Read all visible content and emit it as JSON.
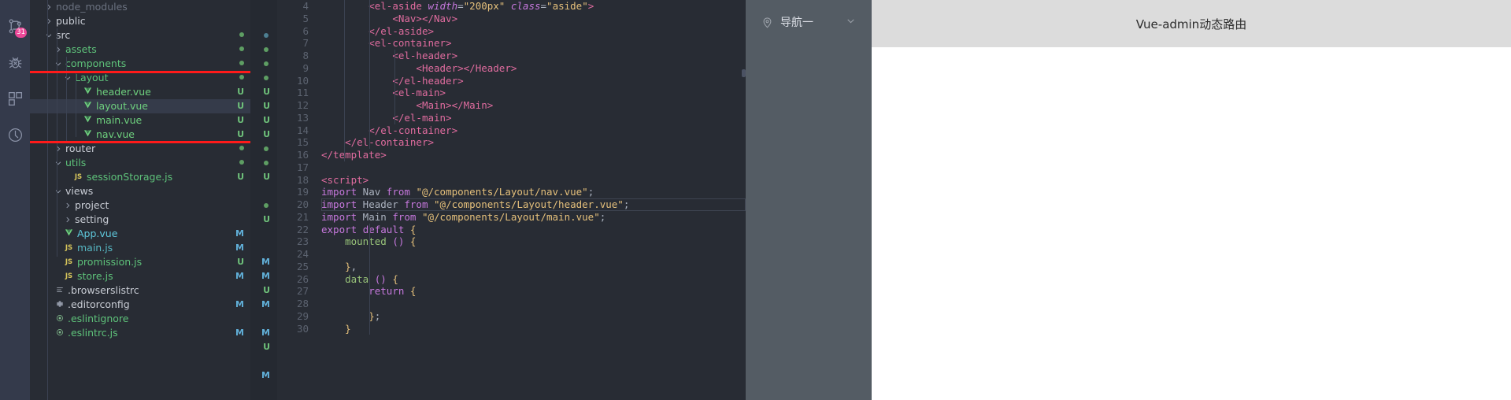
{
  "activitybar": {
    "items": [
      {
        "icon": "source-control-icon",
        "badge": "31"
      },
      {
        "icon": "debug-icon",
        "badge": ""
      },
      {
        "icon": "extensions-icon",
        "badge": ""
      },
      {
        "icon": "clock-icon",
        "badge": ""
      }
    ]
  },
  "explorer": {
    "rows": [
      {
        "label": "node_modules",
        "twisty": "right",
        "icon": "",
        "indent": 1,
        "color": "c-node",
        "status": "",
        "selected": false
      },
      {
        "label": "public",
        "twisty": "right",
        "icon": "",
        "indent": 1,
        "color": "c-folder",
        "status": "",
        "selected": false
      },
      {
        "label": "src",
        "twisty": "down",
        "icon": "",
        "indent": 1,
        "color": "c-folder",
        "status": "dot",
        "selected": false
      },
      {
        "label": "assets",
        "twisty": "right",
        "icon": "",
        "indent": 2,
        "color": "c-green",
        "status": "dot",
        "selected": false
      },
      {
        "label": "components",
        "twisty": "down",
        "icon": "",
        "indent": 2,
        "color": "c-green",
        "status": "dot",
        "selected": false
      },
      {
        "label": "Layout",
        "twisty": "down",
        "icon": "",
        "indent": 3,
        "color": "c-green",
        "status": "dot",
        "selected": false
      },
      {
        "label": "header.vue",
        "twisty": "none",
        "icon": "vue",
        "indent": 4,
        "color": "c-vue",
        "status": "U",
        "selected": false
      },
      {
        "label": "layout.vue",
        "twisty": "none",
        "icon": "vue",
        "indent": 4,
        "color": "c-vue",
        "status": "U",
        "selected": true
      },
      {
        "label": "main.vue",
        "twisty": "none",
        "icon": "vue",
        "indent": 4,
        "color": "c-vue",
        "status": "U",
        "selected": false
      },
      {
        "label": "nav.vue",
        "twisty": "none",
        "icon": "vue",
        "indent": 4,
        "color": "c-vue",
        "status": "U",
        "selected": false
      },
      {
        "label": "router",
        "twisty": "right",
        "icon": "",
        "indent": 2,
        "color": "c-folder",
        "status": "dot",
        "selected": false
      },
      {
        "label": "utils",
        "twisty": "down",
        "icon": "",
        "indent": 2,
        "color": "c-green",
        "status": "dot",
        "selected": false
      },
      {
        "label": "sessionStorage.js",
        "twisty": "none",
        "icon": "js",
        "indent": 3,
        "color": "c-green",
        "status": "U",
        "selected": false
      },
      {
        "label": "views",
        "twisty": "down",
        "icon": "",
        "indent": 2,
        "color": "c-folder",
        "status": "",
        "selected": false
      },
      {
        "label": "project",
        "twisty": "right",
        "icon": "",
        "indent": 3,
        "color": "c-folder",
        "status": "",
        "selected": false
      },
      {
        "label": "setting",
        "twisty": "right",
        "icon": "",
        "indent": 3,
        "color": "c-folder",
        "status": "",
        "selected": false
      },
      {
        "label": "App.vue",
        "twisty": "none",
        "icon": "vue",
        "indent": 2,
        "color": "c-appvue",
        "status": "M",
        "selected": false
      },
      {
        "label": "main.js",
        "twisty": "none",
        "icon": "js",
        "indent": 2,
        "color": "c-mainjs",
        "status": "M",
        "selected": false
      },
      {
        "label": "promission.js",
        "twisty": "none",
        "icon": "js",
        "indent": 2,
        "color": "c-green",
        "status": "U",
        "selected": false
      },
      {
        "label": "store.js",
        "twisty": "none",
        "icon": "js",
        "indent": 2,
        "color": "c-green",
        "status": "M",
        "selected": false
      },
      {
        "label": ".browserslistrc",
        "twisty": "none",
        "icon": "list",
        "indent": 1,
        "color": "c-folder",
        "status": "",
        "selected": false
      },
      {
        "label": ".editorconfig",
        "twisty": "none",
        "icon": "gear",
        "indent": 1,
        "color": "c-folder",
        "status": "M",
        "selected": false
      },
      {
        "label": ".eslintignore",
        "twisty": "none",
        "icon": "circle",
        "indent": 1,
        "color": "c-green",
        "status": "",
        "selected": false
      },
      {
        "label": ".eslintrc.js",
        "twisty": "none",
        "icon": "circle",
        "indent": 1,
        "color": "c-green",
        "status": "M",
        "selected": false
      }
    ],
    "annotation": {
      "color": "#ff1a1a",
      "label": "layout-files-highlight"
    }
  },
  "editor": {
    "first_line_no": 4,
    "active_line_no": 20,
    "lines": [
      {
        "no": 4,
        "indent": 2,
        "tokens": [
          {
            "t": "<el-aside",
            "c": "t-tag"
          },
          {
            "t": " ",
            "c": "t-plain"
          },
          {
            "t": "width",
            "c": "t-attr"
          },
          {
            "t": "=",
            "c": "t-punct"
          },
          {
            "t": "\"200px\"",
            "c": "t-str"
          },
          {
            "t": " ",
            "c": "t-plain"
          },
          {
            "t": "class",
            "c": "t-attr"
          },
          {
            "t": "=",
            "c": "t-punct"
          },
          {
            "t": "\"aside\"",
            "c": "t-str"
          },
          {
            "t": ">",
            "c": "t-tag"
          }
        ]
      },
      {
        "no": 5,
        "indent": 3,
        "tokens": [
          {
            "t": "<Nav>",
            "c": "t-tag"
          },
          {
            "t": "</Nav>",
            "c": "t-tag"
          }
        ]
      },
      {
        "no": 6,
        "indent": 2,
        "tokens": [
          {
            "t": "</el-aside>",
            "c": "t-tag"
          }
        ]
      },
      {
        "no": 7,
        "indent": 2,
        "tokens": [
          {
            "t": "<el-container>",
            "c": "t-tag"
          }
        ]
      },
      {
        "no": 8,
        "indent": 3,
        "tokens": [
          {
            "t": "<el-header>",
            "c": "t-tag"
          }
        ]
      },
      {
        "no": 9,
        "indent": 4,
        "tokens": [
          {
            "t": "<Header>",
            "c": "t-tag"
          },
          {
            "t": "</Header>",
            "c": "t-tag"
          }
        ]
      },
      {
        "no": 10,
        "indent": 3,
        "tokens": [
          {
            "t": "</el-header>",
            "c": "t-tag"
          }
        ]
      },
      {
        "no": 11,
        "indent": 3,
        "tokens": [
          {
            "t": "<el-main>",
            "c": "t-tag"
          }
        ]
      },
      {
        "no": 12,
        "indent": 4,
        "tokens": [
          {
            "t": "<Main>",
            "c": "t-tag"
          },
          {
            "t": "</Main>",
            "c": "t-tag"
          }
        ]
      },
      {
        "no": 13,
        "indent": 3,
        "tokens": [
          {
            "t": "</el-main>",
            "c": "t-tag"
          }
        ]
      },
      {
        "no": 14,
        "indent": 2,
        "tokens": [
          {
            "t": "</el-container>",
            "c": "t-tag"
          }
        ]
      },
      {
        "no": 15,
        "indent": 1,
        "tokens": [
          {
            "t": "</el-container>",
            "c": "t-tag"
          }
        ]
      },
      {
        "no": 16,
        "indent": 0,
        "tokens": [
          {
            "t": "</template>",
            "c": "t-tag"
          }
        ]
      },
      {
        "no": 17,
        "indent": 0,
        "tokens": []
      },
      {
        "no": 18,
        "indent": 0,
        "tokens": [
          {
            "t": "<script>",
            "c": "t-tag"
          }
        ]
      },
      {
        "no": 19,
        "indent": 0,
        "tokens": [
          {
            "t": "import",
            "c": "t-kw"
          },
          {
            "t": " Nav ",
            "c": "t-plain"
          },
          {
            "t": "from",
            "c": "t-kw"
          },
          {
            "t": " ",
            "c": "t-plain"
          },
          {
            "t": "\"@/components/Layout/nav.vue\"",
            "c": "t-yellow"
          },
          {
            "t": ";",
            "c": "t-punct"
          }
        ]
      },
      {
        "no": 20,
        "indent": 0,
        "tokens": [
          {
            "t": "import",
            "c": "t-kw"
          },
          {
            "t": " Header ",
            "c": "t-plain"
          },
          {
            "t": "from",
            "c": "t-kw"
          },
          {
            "t": " ",
            "c": "t-plain"
          },
          {
            "t": "\"@/components/Layout/header.vue\"",
            "c": "t-yellow"
          },
          {
            "t": ";",
            "c": "t-punct"
          }
        ]
      },
      {
        "no": 21,
        "indent": 0,
        "tokens": [
          {
            "t": "import",
            "c": "t-kw"
          },
          {
            "t": " Main ",
            "c": "t-plain"
          },
          {
            "t": "from",
            "c": "t-kw"
          },
          {
            "t": " ",
            "c": "t-plain"
          },
          {
            "t": "\"@/components/Layout/main.vue\"",
            "c": "t-yellow"
          },
          {
            "t": ";",
            "c": "t-punct"
          }
        ]
      },
      {
        "no": 22,
        "indent": 0,
        "tokens": [
          {
            "t": "export",
            "c": "t-kw"
          },
          {
            "t": " ",
            "c": "t-plain"
          },
          {
            "t": "default",
            "c": "t-kw"
          },
          {
            "t": " ",
            "c": "t-plain"
          },
          {
            "t": "{",
            "c": "t-yellow"
          }
        ]
      },
      {
        "no": 23,
        "indent": 1,
        "tokens": [
          {
            "t": "mounted",
            "c": "t-green"
          },
          {
            "t": " ",
            "c": "t-plain"
          },
          {
            "t": "()",
            "c": "t-kw"
          },
          {
            "t": " ",
            "c": "t-plain"
          },
          {
            "t": "{",
            "c": "t-yellow"
          }
        ]
      },
      {
        "no": 24,
        "indent": 0,
        "tokens": []
      },
      {
        "no": 25,
        "indent": 1,
        "tokens": [
          {
            "t": "}",
            "c": "t-yellow"
          },
          {
            "t": ",",
            "c": "t-punct"
          }
        ]
      },
      {
        "no": 26,
        "indent": 1,
        "tokens": [
          {
            "t": "data",
            "c": "t-green"
          },
          {
            "t": " ",
            "c": "t-plain"
          },
          {
            "t": "()",
            "c": "t-kw"
          },
          {
            "t": " ",
            "c": "t-plain"
          },
          {
            "t": "{",
            "c": "t-yellow"
          }
        ]
      },
      {
        "no": 27,
        "indent": 2,
        "tokens": [
          {
            "t": "return",
            "c": "t-kw"
          },
          {
            "t": " ",
            "c": "t-plain"
          },
          {
            "t": "{",
            "c": "t-yellow"
          }
        ]
      },
      {
        "no": 28,
        "indent": 0,
        "tokens": []
      },
      {
        "no": 29,
        "indent": 2,
        "tokens": [
          {
            "t": "}",
            "c": "t-yellow"
          },
          {
            "t": ";",
            "c": "t-punct"
          }
        ]
      },
      {
        "no": 30,
        "indent": 1,
        "tokens": [
          {
            "t": "}",
            "c": "t-yellow"
          }
        ]
      }
    ],
    "gutter_marks": [
      {
        "type": "dot",
        "color": "#4d7f92",
        "line": 2
      },
      {
        "type": "dot",
        "color": "#5e9e63",
        "line": 3
      },
      {
        "type": "dot",
        "color": "#5e9e63",
        "line": 4
      },
      {
        "type": "dot",
        "color": "#5e9e63",
        "line": 5
      },
      {
        "type": "text",
        "text": "U",
        "cls": "st-U",
        "line": 6
      },
      {
        "type": "text",
        "text": "U",
        "cls": "st-U",
        "line": 7
      },
      {
        "type": "text",
        "text": "U",
        "cls": "st-U",
        "line": 8
      },
      {
        "type": "text",
        "text": "U",
        "cls": "st-U",
        "line": 9
      },
      {
        "type": "dot",
        "color": "#5e9e63",
        "line": 10
      },
      {
        "type": "dot",
        "color": "#5e9e63",
        "line": 11
      },
      {
        "type": "text",
        "text": "U",
        "cls": "st-U",
        "line": 12
      },
      {
        "type": "dot",
        "color": "#5e9e63",
        "line": 14
      },
      {
        "type": "text",
        "text": "U",
        "cls": "st-U",
        "line": 15
      },
      {
        "type": "text",
        "text": "M",
        "cls": "st-M",
        "line": 18
      },
      {
        "type": "text",
        "text": "M",
        "cls": "st-M",
        "line": 19
      },
      {
        "type": "text",
        "text": "U",
        "cls": "st-U",
        "line": 20
      },
      {
        "type": "text",
        "text": "M",
        "cls": "st-M",
        "line": 21
      },
      {
        "type": "text",
        "text": "M",
        "cls": "st-M",
        "line": 23
      },
      {
        "type": "text",
        "text": "U",
        "cls": "st-U",
        "line": 24
      },
      {
        "type": "text",
        "text": "M",
        "cls": "st-M",
        "line": 26
      }
    ]
  },
  "preview": {
    "aside": {
      "menu": [
        {
          "icon": "location-pin-icon",
          "label": "导航一",
          "arrow": "chevron-down-icon"
        }
      ]
    },
    "header": {
      "title": "Vue-admin动态路由"
    }
  },
  "colors": {
    "accent_red": "#ff1a1a",
    "editor_bg": "#282c34",
    "sidebar_bg": "#282c34",
    "activitybar_bg": "#343a4b",
    "preview_aside": "#545c64",
    "preview_header": "#dcdcdc",
    "badge_pink": "#ec4899"
  }
}
